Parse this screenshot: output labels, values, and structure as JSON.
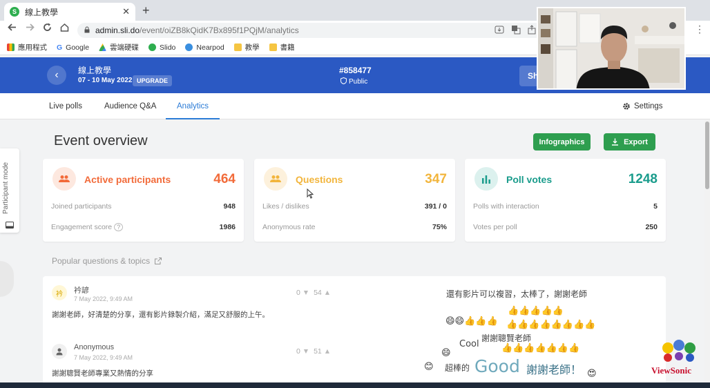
{
  "browser": {
    "tab_title": "線上教學",
    "tab_favicon": "S",
    "close_glyph": "✕",
    "new_tab_glyph": "+",
    "url_host": "admin.sli.do",
    "url_path": "/event/oiZB8kQidK7Bx895f1PQjM/analytics",
    "bookmarks": [
      "應用程式",
      "Google",
      "雲端硬碟",
      "Slido",
      "Nearpod",
      "教學",
      "書籍"
    ]
  },
  "event": {
    "title": "線上教學",
    "dates": "07 - 10 May 2022",
    "upgrade_label": "UPGRADE",
    "code": "#858477",
    "visibility": "Public",
    "share_label": "Sh"
  },
  "subnav": {
    "tabs": [
      "Live polls",
      "Audience Q&A",
      "Analytics"
    ],
    "active_tab": "Analytics",
    "settings_label": "Settings"
  },
  "overview": {
    "title": "Event overview",
    "infographics_label": "Infographics",
    "export_label": "Export",
    "cards": [
      {
        "title": "Active participants",
        "value": "464",
        "color": "#f26b3a",
        "rows": [
          {
            "label": "Joined participants",
            "value": "948"
          },
          {
            "label": "Engagement score",
            "value": "1986"
          }
        ]
      },
      {
        "title": "Questions",
        "value": "347",
        "color": "#f2b53c",
        "rows": [
          {
            "label": "Likes / dislikes",
            "value": "391 / 0"
          },
          {
            "label": "Anonymous rate",
            "value": "75%"
          }
        ]
      },
      {
        "title": "Poll votes",
        "value": "1248",
        "color": "#1a9c8c",
        "rows": [
          {
            "label": "Polls with interaction",
            "value": "5"
          },
          {
            "label": "Votes per poll",
            "value": "250"
          }
        ]
      }
    ]
  },
  "popular": {
    "title": "Popular questions & topics",
    "questions": [
      {
        "author": "衿諺",
        "date": "7 May 2022, 9:49 AM",
        "text": "謝謝老師，好清楚的分享，還有影片錄製介紹，滿足又舒服的上午。",
        "dislikes": "0",
        "likes": "54"
      },
      {
        "author": "Anonymous",
        "date": "7 May 2022, 9:49 AM",
        "text": "謝謝聰賢老師專業又熱情的分享",
        "dislikes": "0",
        "likes": "51"
      }
    ],
    "word_cloud": {
      "phrase1": "還有影片可以複習，太棒了，謝謝老師",
      "phrase2": "謝謝聰賢老師",
      "word_cool": "Cool",
      "word_great": "超棒的",
      "word_good": "Good",
      "word_thanks": "謝謝老師！",
      "thumbs5": "👍👍👍👍👍",
      "thumbs_row2": "😄😄👍👍👍",
      "thumbs7": "👍👍👍👍👍👍👍",
      "thumbs8": "👍👍👍👍👍👍👍👍",
      "smile": "😄",
      "smile_eyes": "😊",
      "heart_eyes": "😍"
    }
  },
  "side": {
    "participant_mode_label": "Participant mode"
  },
  "brand": {
    "viewsonic": "ViewSonic"
  },
  "colors": {
    "header_blue": "#2b59c3",
    "accent_blue": "#2b7bd6",
    "button_green": "#2e9e4f"
  }
}
